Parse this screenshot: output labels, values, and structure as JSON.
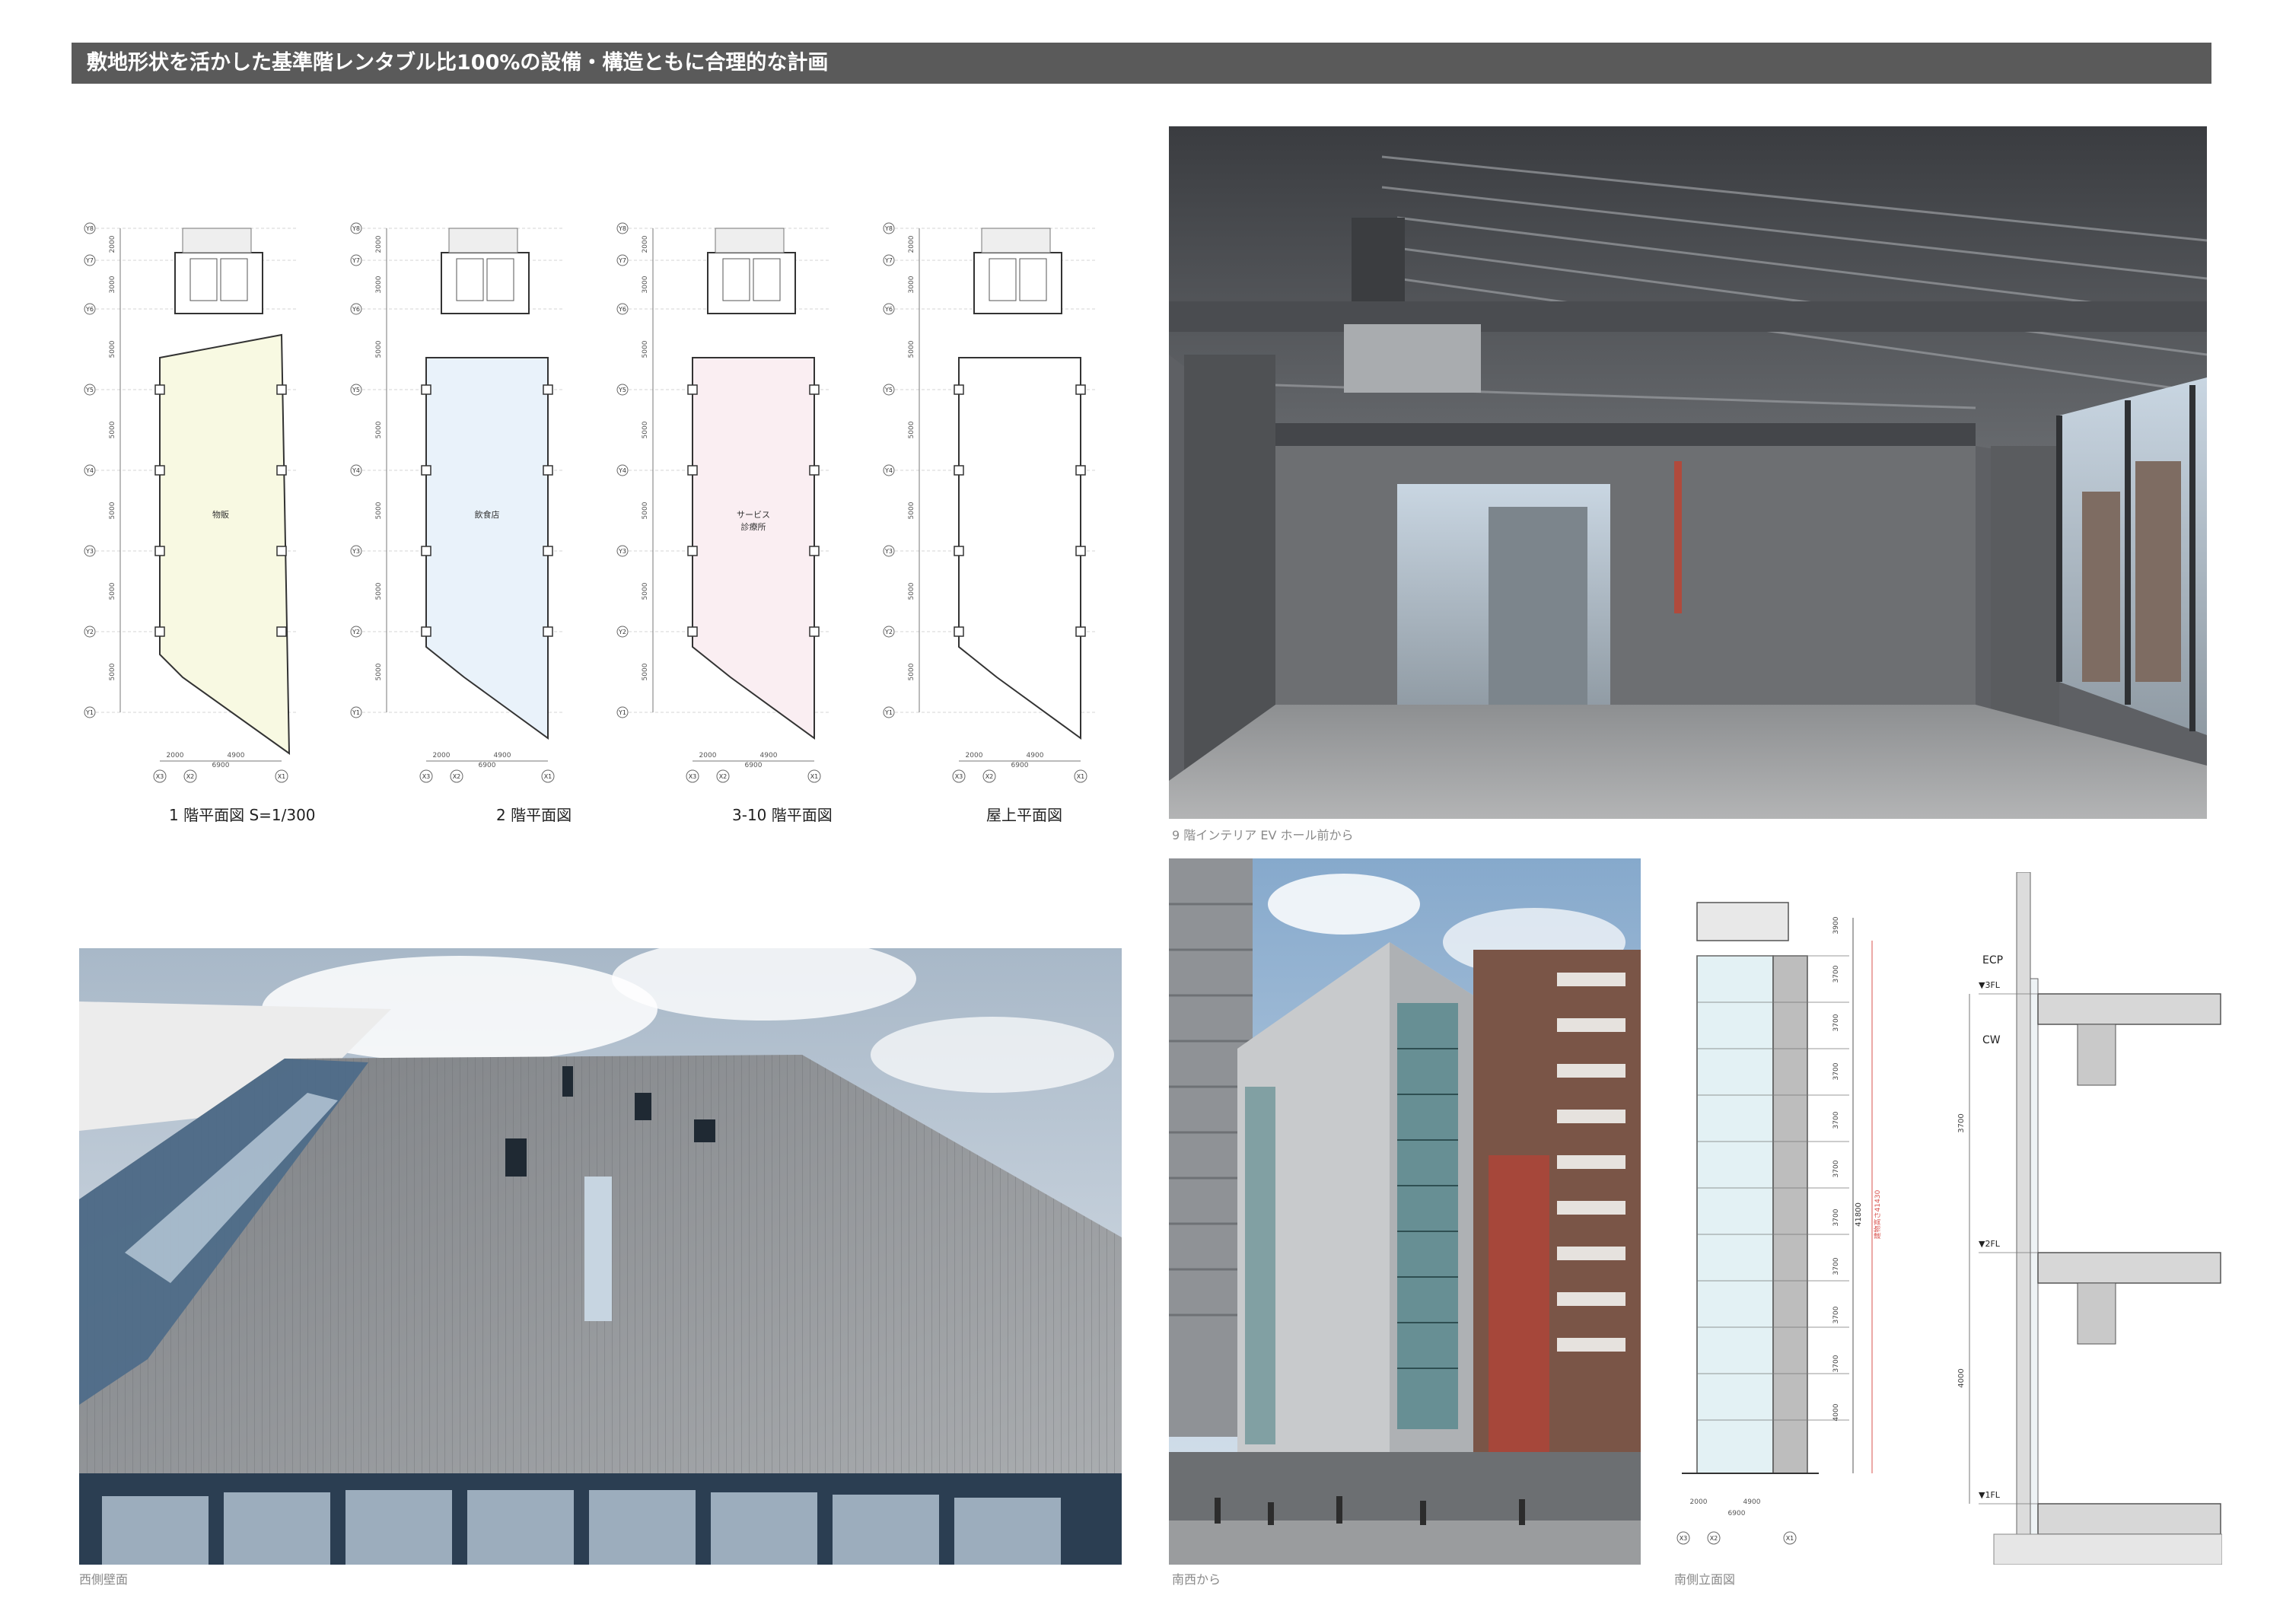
{
  "header": {
    "title": "敷地形状を活かした基準階レンタブル比100%の設備・構造ともに合理的な計画"
  },
  "plans": {
    "grid_rows": [
      "Y8",
      "Y7",
      "Y6",
      "Y5",
      "Y4",
      "Y3",
      "Y2",
      "Y1"
    ],
    "row_dims": [
      "2000",
      "3000",
      "5000",
      "5000",
      "5000",
      "5000",
      "5000",
      "5000"
    ],
    "grid_cols": [
      "X3",
      "X2",
      "X1"
    ],
    "col_dims": [
      "2000",
      "4900",
      "6900"
    ],
    "items": [
      {
        "caption": "1 階平面図 S=1/300",
        "room": "物販",
        "room2": "",
        "fill": "#f8f9e2"
      },
      {
        "caption": "2 階平面図",
        "room": "飲食店",
        "room2": "",
        "fill": "#e9f2fa"
      },
      {
        "caption": "3-10 階平面図",
        "room": "サービス",
        "room2": "診療所",
        "fill": "#faeef2"
      },
      {
        "caption": "屋上平面図",
        "room": "",
        "room2": "",
        "fill": "#ffffff"
      }
    ]
  },
  "photos": {
    "interior_caption": "9 階インテリア EV ホール前から",
    "west_caption": "西側壁面",
    "southwest_caption": "南西から",
    "elevation_caption": "南側立面図"
  },
  "elevation": {
    "floor_heights": [
      "3900",
      "3700",
      "3700",
      "3700",
      "3700",
      "3700",
      "3700",
      "3700",
      "3700",
      "3700",
      "4000"
    ],
    "total_height": "41800",
    "legal_height": "建物高さ41430",
    "bottom_dims": [
      "2000",
      "4900",
      "6900"
    ],
    "bottom_grid": [
      "X3",
      "X2",
      "X1"
    ]
  },
  "section_detail": {
    "labels": [
      "ECP",
      "CW"
    ],
    "floors": [
      "▼3FL",
      "▼2FL",
      "▼1FL"
    ],
    "heights": [
      "3700",
      "4000"
    ]
  },
  "colors": {
    "banner": "#5a5a5a",
    "caption": "#8a8a8a",
    "legal_line": "#d9534f"
  }
}
